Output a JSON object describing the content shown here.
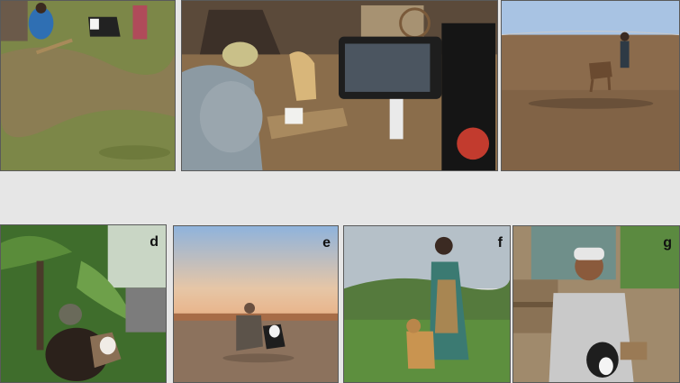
{
  "panels": [
    {
      "id": "a",
      "label": ""
    },
    {
      "id": "b",
      "label": ""
    },
    {
      "id": "c",
      "label": ""
    },
    {
      "id": "d",
      "label": "d"
    },
    {
      "id": "e",
      "label": "e"
    },
    {
      "id": "f",
      "label": "f"
    },
    {
      "id": "g",
      "label": "g"
    }
  ],
  "colors": {
    "background": "#e6e6e6",
    "grass": "#7f8a45",
    "dirt": "#9a7b55",
    "sky_blue": "#8fb3dc",
    "dusk_orange": "#e9b48a",
    "jungle_green": "#3c6a2a"
  }
}
